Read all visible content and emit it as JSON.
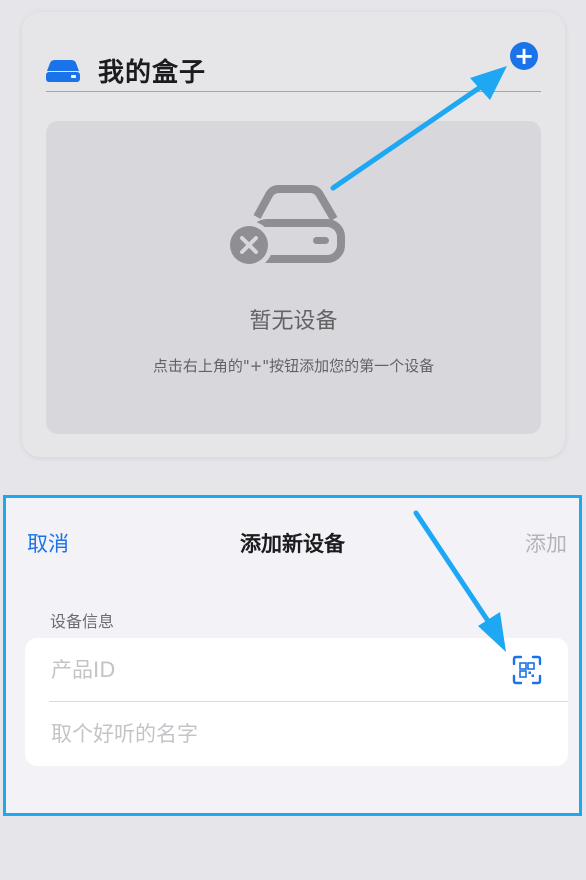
{
  "card": {
    "icon": "hard-drive-icon",
    "title": "我的盒子",
    "add_button": "+",
    "empty_state": {
      "icon": "disconnected-drive-icon",
      "title": "暂无设备",
      "hint": "点击右上角的\"+\"按钮添加您的第一个设备"
    }
  },
  "sheet": {
    "cancel_label": "取消",
    "title": "添加新设备",
    "add_label": "添加",
    "section_label": "设备信息",
    "fields": {
      "product_id_placeholder": "产品ID",
      "name_placeholder": "取个好听的名字"
    },
    "scan_icon": "qr-scan-icon"
  },
  "colors": {
    "accent": "#1a73e8",
    "annotation": "#1ea7f2",
    "disabled": "#b4b4b8"
  }
}
